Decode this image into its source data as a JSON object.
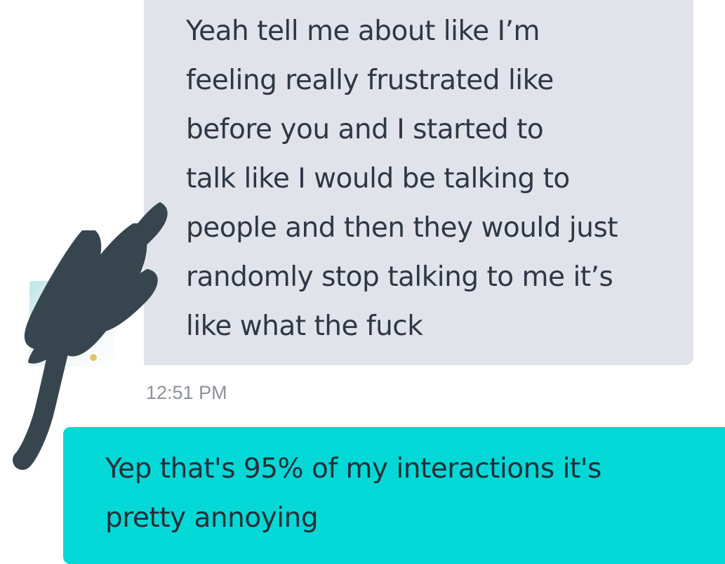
{
  "conversation": {
    "received_message": {
      "text": "Yeah tell me about like I’m\nfeeling really frustrated like\nbefore you and I started to\ntalk like I would be talking to\npeople and then they would just\nrandomly stop talking to me it’s\nlike what the fuck",
      "timestamp": "12:51 PM"
    },
    "sent_message": {
      "text": "Yep that's 95% of my interactions it's pretty annoying"
    }
  },
  "colors": {
    "received_bubble": "#e1e3ea",
    "sent_bubble": "#03d8d7",
    "text": "#2e3744",
    "timestamp": "#8b9099",
    "redaction_scribble": "#37454e"
  }
}
